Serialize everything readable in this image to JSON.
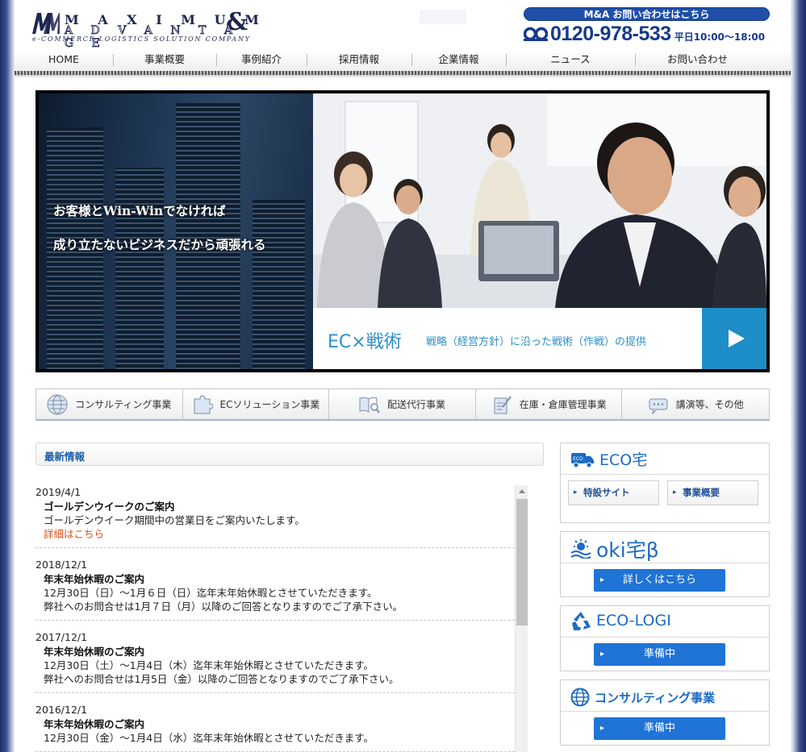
{
  "header": {
    "logo_line1": "M A X I M U M",
    "logo_amp": "&",
    "logo_line2": "A D V A N T A G E",
    "logo_line3": "e-COMMERCE LOGISTICS SOLUTION COMPANY",
    "ma_button": "M&A お問い合わせはこちら",
    "phone_number": "0120-978-533",
    "phone_hours": "平日10:00〜18:00"
  },
  "nav": [
    {
      "label": "HOME",
      "name": "nav-home"
    },
    {
      "label": "事業概要",
      "name": "nav-business"
    },
    {
      "label": "事例紹介",
      "name": "nav-cases"
    },
    {
      "label": "採用情報",
      "name": "nav-recruit"
    },
    {
      "label": "企業情報",
      "name": "nav-company"
    },
    {
      "label": "ニュース",
      "name": "nav-news"
    },
    {
      "label": "お問い合わせ",
      "name": "nav-contact"
    }
  ],
  "hero": {
    "copy_line1": "お客様とWin-Winでなければ",
    "copy_line2": "成り立たないビジネスだから頑張れる",
    "caption_title": "EC×戦術",
    "caption_sub": "戦略（経営方針）に沿った戦術（作戦）の提供"
  },
  "services": [
    {
      "label": "コンサルティング事業",
      "icon": "globe-icon"
    },
    {
      "label": "ECソリューション事業",
      "icon": "puzzle-icon"
    },
    {
      "label": "配送代行事業",
      "icon": "book-search-icon"
    },
    {
      "label": "在庫・倉庫管理事業",
      "icon": "clipboard-pen-icon"
    },
    {
      "label": "講演等、その他",
      "icon": "speech-bubble-icon"
    }
  ],
  "news": {
    "header": "最新情報",
    "items": [
      {
        "date": "2019/4/1",
        "title": "ゴールデンウイークのご案内",
        "body": [
          "ゴールデンウイーク期間中の営業日をご案内いたします。"
        ],
        "link": "詳細はこちら"
      },
      {
        "date": "2018/12/1",
        "title": "年末年始休暇のご案内",
        "body": [
          "12月30日（日）～1月６日（日）迄年末年始休暇とさせていただきます。",
          "弊社へのお問合せは1月７日（月）以降のご回答となりますのでご了承下さい。"
        ]
      },
      {
        "date": "2017/12/1",
        "title": "年末年始休暇のご案内",
        "body": [
          "12月30日（土）～1月4日（木）迄年末年始休暇とさせていただきます。",
          "弊社へのお問合せは1月5日（金）以降のご回答となりますのでご了承下さい。"
        ]
      },
      {
        "date": "2016/12/1",
        "title": "年末年始休暇のご案内",
        "body": [
          "12月30日（金）～1月4日（水）迄年末年始休暇とさせていただきます。"
        ]
      }
    ]
  },
  "sidebar": {
    "eco": {
      "title": "ECO宅",
      "btn1": "特設サイト",
      "btn2": "事業概要"
    },
    "oki": {
      "title": "oki宅β",
      "button": "詳しくはこちら"
    },
    "ecologi": {
      "title": "ECO-LOGI",
      "button": "準備中"
    },
    "consulting": {
      "title": "コンサルティング事業",
      "button": "準備中"
    }
  },
  "colors": {
    "brand_navy": "#1d2550",
    "accent_blue": "#1f74d6",
    "caption_blue": "#2d8fc6",
    "link_orange": "#d0521a"
  }
}
